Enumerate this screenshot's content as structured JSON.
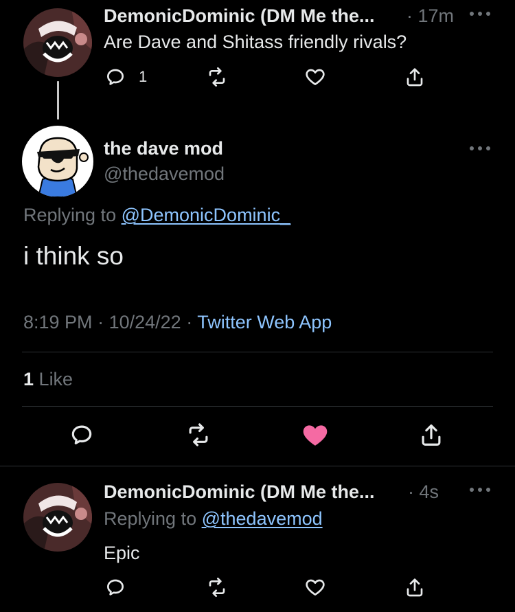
{
  "parent_tweet": {
    "author_name": "DemonicDominic (DM Me the...",
    "time": "· 17m",
    "text": "Are Dave and Shitass friendly rivals?",
    "reply_count": "1"
  },
  "main_tweet": {
    "author_name": "the dave mod",
    "handle": "@thedavemod",
    "replying_prefix": "Replying to",
    "replying_to": "@DemonicDominic_",
    "text": "i think so",
    "time": "8:19 PM",
    "sep1": "·",
    "date": "10/24/22",
    "sep2": "·",
    "source": "Twitter Web App",
    "like_count": "1",
    "like_label": "Like"
  },
  "reply_tweet": {
    "author_name": "DemonicDominic (DM Me the...",
    "time": "· 4s",
    "replying_prefix": "Replying to",
    "replying_to": "@thedavemod",
    "text": "Epic"
  },
  "colors": {
    "background": "#000000",
    "text_primary": "#e7e9ea",
    "text_secondary": "#71767b",
    "link": "#8ec5ff",
    "liked": "#f91880",
    "divider": "#2f3336"
  },
  "icons": {
    "reply": "reply-bubble-icon",
    "retweet": "retweet-icon",
    "like": "heart-icon",
    "share": "share-icon",
    "more": "more-dots-icon"
  }
}
